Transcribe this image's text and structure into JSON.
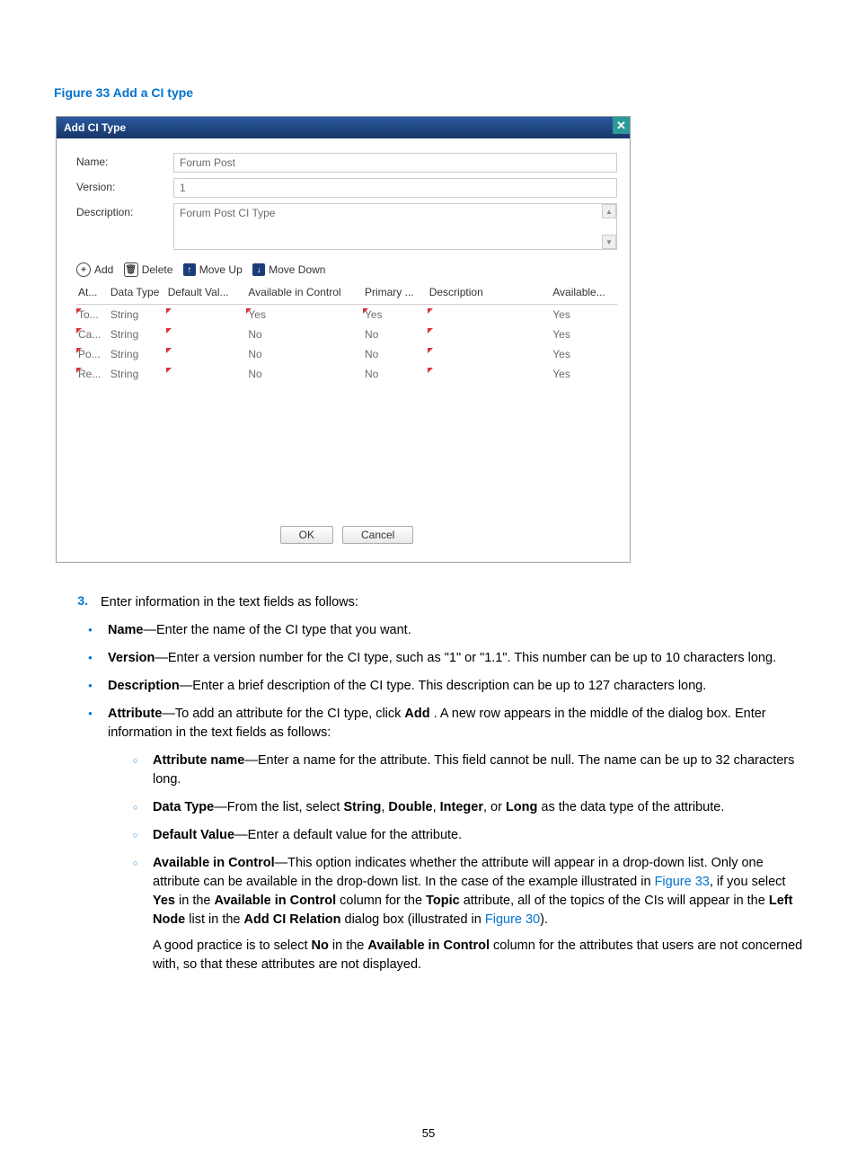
{
  "figure": {
    "caption": "Figure 33 Add a CI type"
  },
  "dialog": {
    "title": "Add CI Type",
    "fields": {
      "name_label": "Name:",
      "name_value": "Forum Post",
      "version_label": "Version:",
      "version_value": "1",
      "desc_label": "Description:",
      "desc_value": "Forum Post CI Type"
    },
    "toolbar": {
      "add": "Add",
      "delete": "Delete",
      "moveup": "Move Up",
      "movedown": "Move Down"
    },
    "headers": {
      "c0": "At...",
      "c1": "Data Type",
      "c2": "Default Val...",
      "c3": "Available in Control",
      "c4": "Primary ...",
      "c5": "Description",
      "c6": "Available..."
    },
    "rows": [
      {
        "at": "To...",
        "dt": "String",
        "dv": "",
        "ac": "Yes",
        "pk": "Yes",
        "desc": "",
        "av": "Yes"
      },
      {
        "at": "Ca...",
        "dt": "String",
        "dv": "",
        "ac": "No",
        "pk": "No",
        "desc": "",
        "av": "Yes"
      },
      {
        "at": "Po...",
        "dt": "String",
        "dv": "",
        "ac": "No",
        "pk": "No",
        "desc": "",
        "av": "Yes"
      },
      {
        "at": "Re...",
        "dt": "String",
        "dv": "",
        "ac": "No",
        "pk": "No",
        "desc": "",
        "av": "Yes"
      }
    ],
    "buttons": {
      "ok": "OK",
      "cancel": "Cancel"
    }
  },
  "doc": {
    "step_no": "3.",
    "step_text": "Enter information in the text fields as follows:",
    "bullets": {
      "name": {
        "label": "Name",
        "text": "—Enter the name of the CI type that you want."
      },
      "version": {
        "label": "Version",
        "text": "—Enter a version number for the CI type, such as \"1\" or \"1.1\". This number can be up to 10 characters long."
      },
      "desc": {
        "label": "Description",
        "text": "—Enter a brief description of the CI type. This description can be up to 127 characters long."
      },
      "attr": {
        "label": "Attribute",
        "pre": "—To add an attribute for the CI type, click ",
        "add": "Add",
        "post": " . A new row appears in the middle of the dialog box. Enter information in the text fields as follows:"
      },
      "sub": {
        "an": {
          "label": "Attribute name",
          "text": "—Enter a name for the attribute. This field cannot be null. The name can be up to 32 characters long."
        },
        "dt": {
          "label": "Data Type",
          "pre": "—From the list, select ",
          "s": "String",
          "c1": ", ",
          "d": "Double",
          "c2": ", ",
          "i": "Integer",
          "c3": ", or ",
          "l": "Long",
          "post": " as the data type of the attribute."
        },
        "dv": {
          "label": "Default Value",
          "text": "—Enter a default value for the attribute."
        },
        "ac": {
          "label": "Available in Control",
          "t1": "—This option indicates whether the attribute will appear in a drop-down list. Only one attribute can be available in the drop-down list. In the case of the example illustrated in ",
          "fig33": "Figure 33",
          "t2": ", if you select ",
          "yes": "Yes",
          "t3": " in the ",
          "aic": "Available in Control",
          "t4": " column for the ",
          "topic": "Topic",
          "t5": " attribute, all of the topics of the CIs will appear in the ",
          "ln": "Left Node",
          "t6": " list in the ",
          "acr": "Add CI Relation",
          "t7": " dialog box (illustrated in ",
          "fig30": "Figure 30",
          "t8": ").",
          "p2a": "A good practice is to select ",
          "no": "No",
          "p2b": " in the ",
          "aic2": "Available in Control",
          "p2c": " column for the attributes that users are not concerned with, so that these attributes are not displayed."
        }
      }
    },
    "page_no": "55"
  }
}
